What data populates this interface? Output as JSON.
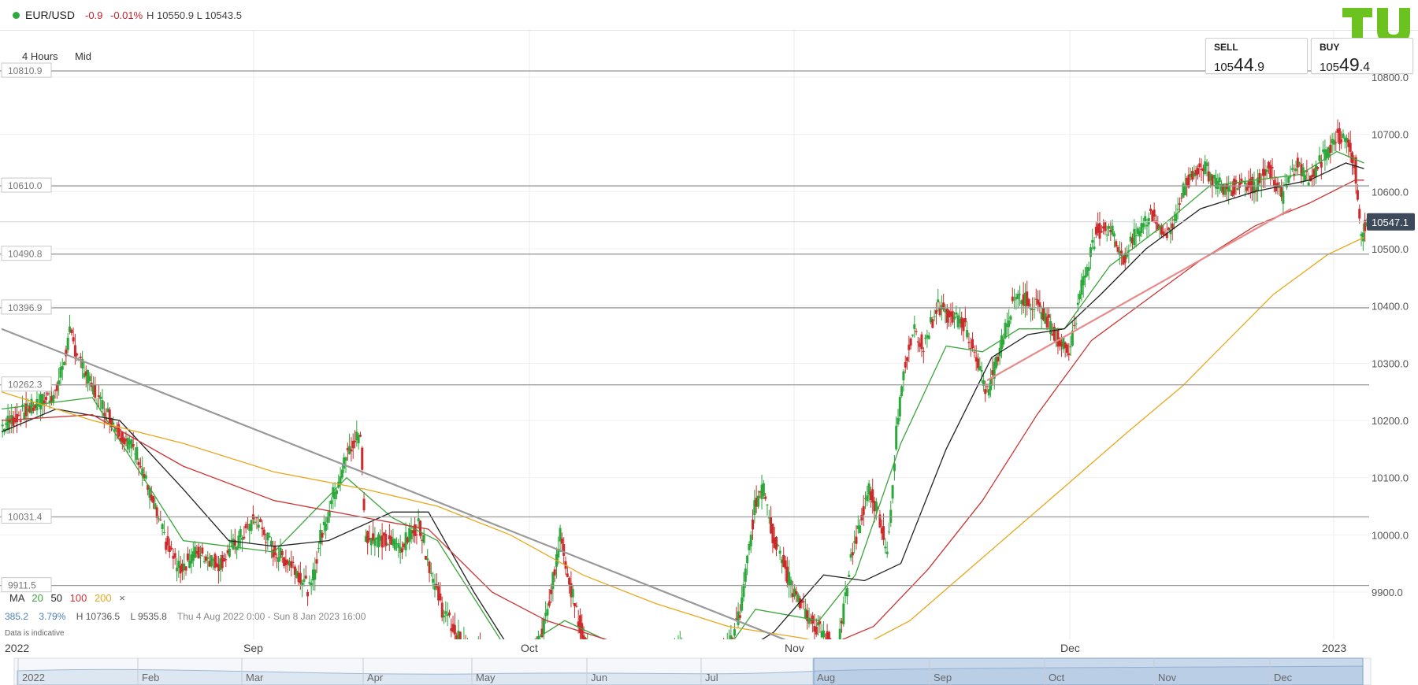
{
  "header": {
    "symbol": "EUR/USD",
    "change": "-0.9",
    "change_pct": "-0.01%",
    "high_low": "H 10550.9  L 10543.5",
    "logo_text": "TU"
  },
  "toolbar": {
    "interval": "4 Hours",
    "price_type": "Mid"
  },
  "sell": {
    "label": "SELL",
    "prefix": "105",
    "big": "44",
    "frac": ".9"
  },
  "buy": {
    "label": "BUY",
    "prefix": "105",
    "big": "49",
    "frac": ".4"
  },
  "colors": {
    "up": "#2aa83a",
    "down": "#cc2b2b",
    "ma20": "#3aa53a",
    "ma50": "#222222",
    "ma100": "#cc3333",
    "ma200": "#e8a81d",
    "current_tag": "#3d4a5c",
    "accent_logo": "#6cc21e"
  },
  "legend": {
    "ma_label": "MA",
    "ma20": "20",
    "ma50": "50",
    "ma100": "100",
    "ma200": "200",
    "close": "×"
  },
  "stats": {
    "change": "385.2",
    "change_pct": "3.79%",
    "high": "H 10736.5",
    "low": "L 9535.8",
    "range": "Thu 4 Aug 2022 0:00 - Sun 8 Jan 2023 16:00"
  },
  "indicative": "Data is indicative",
  "chart_data": {
    "type": "candlestick",
    "y_axis": {
      "ylim": [
        9820,
        10820
      ],
      "ticks": [
        9900.0,
        10000.0,
        10100.0,
        10200.0,
        10300.0,
        10400.0,
        10500.0,
        10600.0,
        10700.0,
        10800.0
      ],
      "tick_labels": [
        "9900.0",
        "10000.0",
        "10100.0",
        "10200.0",
        "10300.0",
        "10400.0",
        "10500.0",
        "10600.0",
        "10700.0",
        "10800.0"
      ]
    },
    "x_axis": {
      "labels": [
        "2022",
        "Sep",
        "Oct",
        "Nov",
        "Dec",
        "2023"
      ]
    },
    "levels": [
      10810.9,
      10610.0,
      10490.8,
      10396.9,
      10262.3,
      10031.4,
      9911.5
    ],
    "level_labels": [
      "10810.9",
      "10610.0",
      "10490.8",
      "10396.9",
      "10262.3",
      "10031.4",
      "9911.5"
    ],
    "current_price": 10547.1,
    "current_price_label": "10547.1",
    "key_points_close": [
      [
        0,
        10190
      ],
      [
        30,
        10220
      ],
      [
        60,
        10250
      ],
      [
        75,
        10350
      ],
      [
        90,
        10290
      ],
      [
        105,
        10240
      ],
      [
        130,
        10180
      ],
      [
        150,
        10140
      ],
      [
        165,
        10060
      ],
      [
        180,
        9990
      ],
      [
        195,
        9940
      ],
      [
        215,
        9970
      ],
      [
        240,
        9950
      ],
      [
        260,
        9990
      ],
      [
        280,
        10030
      ],
      [
        300,
        9970
      ],
      [
        320,
        9950
      ],
      [
        340,
        9900
      ],
      [
        350,
        9990
      ],
      [
        365,
        10070
      ],
      [
        380,
        10140
      ],
      [
        395,
        10180
      ],
      [
        400,
        10000
      ],
      [
        420,
        9990
      ],
      [
        440,
        9980
      ],
      [
        460,
        10020
      ],
      [
        470,
        9950
      ],
      [
        485,
        9870
      ],
      [
        510,
        9800
      ],
      [
        560,
        9780
      ],
      [
        580,
        9750
      ],
      [
        600,
        9860
      ],
      [
        615,
        10000
      ],
      [
        625,
        9920
      ],
      [
        635,
        9850
      ],
      [
        650,
        9780
      ],
      [
        720,
        9750
      ],
      [
        745,
        9800
      ],
      [
        760,
        9780
      ],
      [
        780,
        9770
      ],
      [
        800,
        9800
      ],
      [
        815,
        9880
      ],
      [
        830,
        10060
      ],
      [
        840,
        10080
      ],
      [
        850,
        9990
      ],
      [
        860,
        9950
      ],
      [
        875,
        9890
      ],
      [
        890,
        9850
      ],
      [
        905,
        9830
      ],
      [
        920,
        9790
      ],
      [
        935,
        9960
      ],
      [
        945,
        10020
      ],
      [
        955,
        10080
      ],
      [
        965,
        10040
      ],
      [
        975,
        9970
      ],
      [
        985,
        10180
      ],
      [
        995,
        10300
      ],
      [
        1005,
        10360
      ],
      [
        1015,
        10330
      ],
      [
        1030,
        10400
      ],
      [
        1045,
        10380
      ],
      [
        1060,
        10370
      ],
      [
        1075,
        10290
      ],
      [
        1085,
        10250
      ],
      [
        1100,
        10330
      ],
      [
        1115,
        10420
      ],
      [
        1130,
        10410
      ],
      [
        1145,
        10390
      ],
      [
        1160,
        10350
      ],
      [
        1175,
        10320
      ],
      [
        1190,
        10440
      ],
      [
        1205,
        10530
      ],
      [
        1220,
        10540
      ],
      [
        1235,
        10480
      ],
      [
        1250,
        10530
      ],
      [
        1265,
        10560
      ],
      [
        1285,
        10520
      ],
      [
        1300,
        10600
      ],
      [
        1320,
        10650
      ],
      [
        1335,
        10620
      ],
      [
        1350,
        10600
      ],
      [
        1365,
        10620
      ],
      [
        1380,
        10610
      ],
      [
        1395,
        10640
      ],
      [
        1410,
        10590
      ],
      [
        1425,
        10650
      ],
      [
        1440,
        10620
      ],
      [
        1455,
        10660
      ],
      [
        1470,
        10700
      ],
      [
        1480,
        10690
      ],
      [
        1490,
        10650
      ],
      [
        1496,
        10520
      ],
      [
        1503,
        10547
      ]
    ],
    "ma_series": {
      "ma20": [
        [
          0,
          10220
        ],
        [
          100,
          10240
        ],
        [
          200,
          9990
        ],
        [
          300,
          9970
        ],
        [
          380,
          10100
        ],
        [
          430,
          10030
        ],
        [
          480,
          9990
        ],
        [
          560,
          9790
        ],
        [
          620,
          9850
        ],
        [
          700,
          9790
        ],
        [
          790,
          9780
        ],
        [
          830,
          9870
        ],
        [
          900,
          9850
        ],
        [
          940,
          9930
        ],
        [
          990,
          10160
        ],
        [
          1040,
          10330
        ],
        [
          1080,
          10320
        ],
        [
          1120,
          10360
        ],
        [
          1170,
          10360
        ],
        [
          1220,
          10470
        ],
        [
          1270,
          10530
        ],
        [
          1330,
          10610
        ],
        [
          1380,
          10620
        ],
        [
          1430,
          10630
        ],
        [
          1470,
          10670
        ],
        [
          1500,
          10650
        ]
      ],
      "ma50": [
        [
          0,
          10180
        ],
        [
          60,
          10220
        ],
        [
          130,
          10200
        ],
        [
          200,
          10080
        ],
        [
          250,
          9990
        ],
        [
          300,
          9980
        ],
        [
          360,
          9990
        ],
        [
          430,
          10040
        ],
        [
          470,
          10040
        ],
        [
          520,
          9900
        ],
        [
          560,
          9800
        ],
        [
          640,
          9780
        ],
        [
          700,
          9770
        ],
        [
          800,
          9780
        ],
        [
          850,
          9830
        ],
        [
          905,
          9930
        ],
        [
          950,
          9920
        ],
        [
          990,
          9950
        ],
        [
          1040,
          10150
        ],
        [
          1090,
          10310
        ],
        [
          1130,
          10350
        ],
        [
          1170,
          10360
        ],
        [
          1210,
          10420
        ],
        [
          1260,
          10500
        ],
        [
          1320,
          10570
        ],
        [
          1380,
          10600
        ],
        [
          1440,
          10620
        ],
        [
          1480,
          10650
        ],
        [
          1500,
          10640
        ]
      ],
      "ma100": [
        [
          0,
          10200
        ],
        [
          100,
          10210
        ],
        [
          200,
          10120
        ],
        [
          300,
          10060
        ],
        [
          400,
          10030
        ],
        [
          470,
          10010
        ],
        [
          540,
          9900
        ],
        [
          600,
          9850
        ],
        [
          700,
          9800
        ],
        [
          800,
          9770
        ],
        [
          860,
          9780
        ],
        [
          900,
          9800
        ],
        [
          960,
          9840
        ],
        [
          1020,
          9940
        ],
        [
          1080,
          10060
        ],
        [
          1140,
          10210
        ],
        [
          1200,
          10340
        ],
        [
          1260,
          10410
        ],
        [
          1320,
          10480
        ],
        [
          1380,
          10540
        ],
        [
          1440,
          10580
        ],
        [
          1490,
          10620
        ],
        [
          1500,
          10620
        ]
      ],
      "ma200": [
        [
          0,
          10250
        ],
        [
          100,
          10200
        ],
        [
          200,
          10160
        ],
        [
          300,
          10110
        ],
        [
          400,
          10080
        ],
        [
          480,
          10050
        ],
        [
          560,
          10000
        ],
        [
          640,
          9930
        ],
        [
          720,
          9880
        ],
        [
          800,
          9840
        ],
        [
          880,
          9820
        ],
        [
          940,
          9800
        ],
        [
          1000,
          9850
        ],
        [
          1080,
          9960
        ],
        [
          1160,
          10070
        ],
        [
          1240,
          10180
        ],
        [
          1300,
          10260
        ],
        [
          1350,
          10340
        ],
        [
          1400,
          10420
        ],
        [
          1460,
          10490
        ],
        [
          1500,
          10520
        ]
      ]
    },
    "trendlines": [
      {
        "name": "downtrend",
        "points": [
          [
            0,
            10360
          ],
          [
            905,
            9790
          ]
        ]
      },
      {
        "name": "uptrend",
        "points": [
          [
            1085,
            10270
          ],
          [
            1420,
            10570
          ]
        ]
      }
    ]
  },
  "navigator": {
    "labels": [
      "2022",
      "Feb",
      "Mar",
      "Apr",
      "May",
      "Jun",
      "Jul",
      "Aug",
      "Sep",
      "Oct",
      "Nov",
      "Dec"
    ]
  }
}
